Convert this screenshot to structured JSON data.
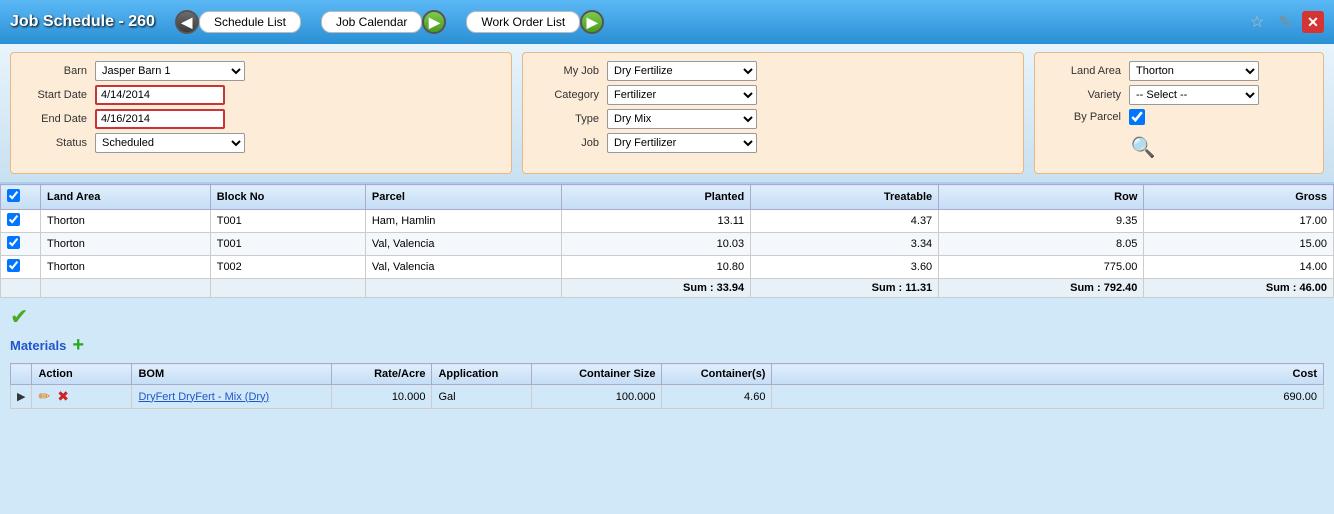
{
  "header": {
    "title": "Job Schedule - 260",
    "nav_items": [
      {
        "label": "Schedule List",
        "has_left_arrow": true,
        "has_right_arrow": false
      },
      {
        "label": "Job Calendar",
        "has_left_arrow": false,
        "has_right_arrow": true
      },
      {
        "label": "Work Order List",
        "has_left_arrow": false,
        "has_right_arrow": true
      }
    ]
  },
  "form": {
    "left": {
      "barn_label": "Barn",
      "barn_value": "Jasper Barn 1",
      "start_date_label": "Start Date",
      "start_date_value": "4/14/2014",
      "end_date_label": "End Date",
      "end_date_value": "4/16/2014",
      "status_label": "Status",
      "status_value": "Scheduled"
    },
    "middle": {
      "my_job_label": "My Job",
      "my_job_value": "Dry Fertilize",
      "category_label": "Category",
      "category_value": "Fertilizer",
      "type_label": "Type",
      "type_value": "Dry Mix",
      "job_label": "Job",
      "job_value": "Dry Fertilizer"
    },
    "right": {
      "land_area_label": "Land Area",
      "land_area_value": "Thorton",
      "variety_label": "Variety",
      "variety_value": "-- Select --",
      "by_parcel_label": "By Parcel",
      "by_parcel_checked": true
    }
  },
  "land_table": {
    "columns": [
      "",
      "Land Area",
      "Block No",
      "Parcel",
      "Planted",
      "Treatable",
      "Row",
      "Gross"
    ],
    "rows": [
      {
        "checked": true,
        "land_area": "Thorton",
        "block_no": "T001",
        "parcel": "Ham, Hamlin",
        "planted": "13.11",
        "treatable": "4.37",
        "row": "9.35",
        "gross": "17.00"
      },
      {
        "checked": true,
        "land_area": "Thorton",
        "block_no": "T001",
        "parcel": "Val, Valencia",
        "planted": "10.03",
        "treatable": "3.34",
        "row": "8.05",
        "gross": "15.00"
      },
      {
        "checked": true,
        "land_area": "Thorton",
        "block_no": "T002",
        "parcel": "Val, Valencia",
        "planted": "10.80",
        "treatable": "3.60",
        "row": "775.00",
        "gross": "14.00"
      }
    ],
    "sums": {
      "planted": "Sum : 33.94",
      "treatable": "Sum : 11.31",
      "row": "Sum : 792.40",
      "gross": "Sum : 46.00"
    }
  },
  "materials": {
    "label": "Materials",
    "add_label": "+",
    "columns": [
      "",
      "Action",
      "BOM",
      "Rate/Acre",
      "Application",
      "Container Size",
      "Container(s)",
      "Cost"
    ],
    "rows": [
      {
        "arrow": "▶",
        "bom": "DryFert DryFert - Mix (Dry)",
        "rate_acre": "10.000",
        "application": "Gal",
        "container_size": "100.000",
        "containers": "4.60",
        "cost": "690.00"
      }
    ]
  },
  "icons": {
    "star": "☆",
    "edit": "✎",
    "close": "✕",
    "search": "🔍",
    "checkmark": "✔",
    "left_arrow": "◀",
    "right_arrow": "▶",
    "edit_pencil": "✏",
    "delete_x": "✖"
  }
}
